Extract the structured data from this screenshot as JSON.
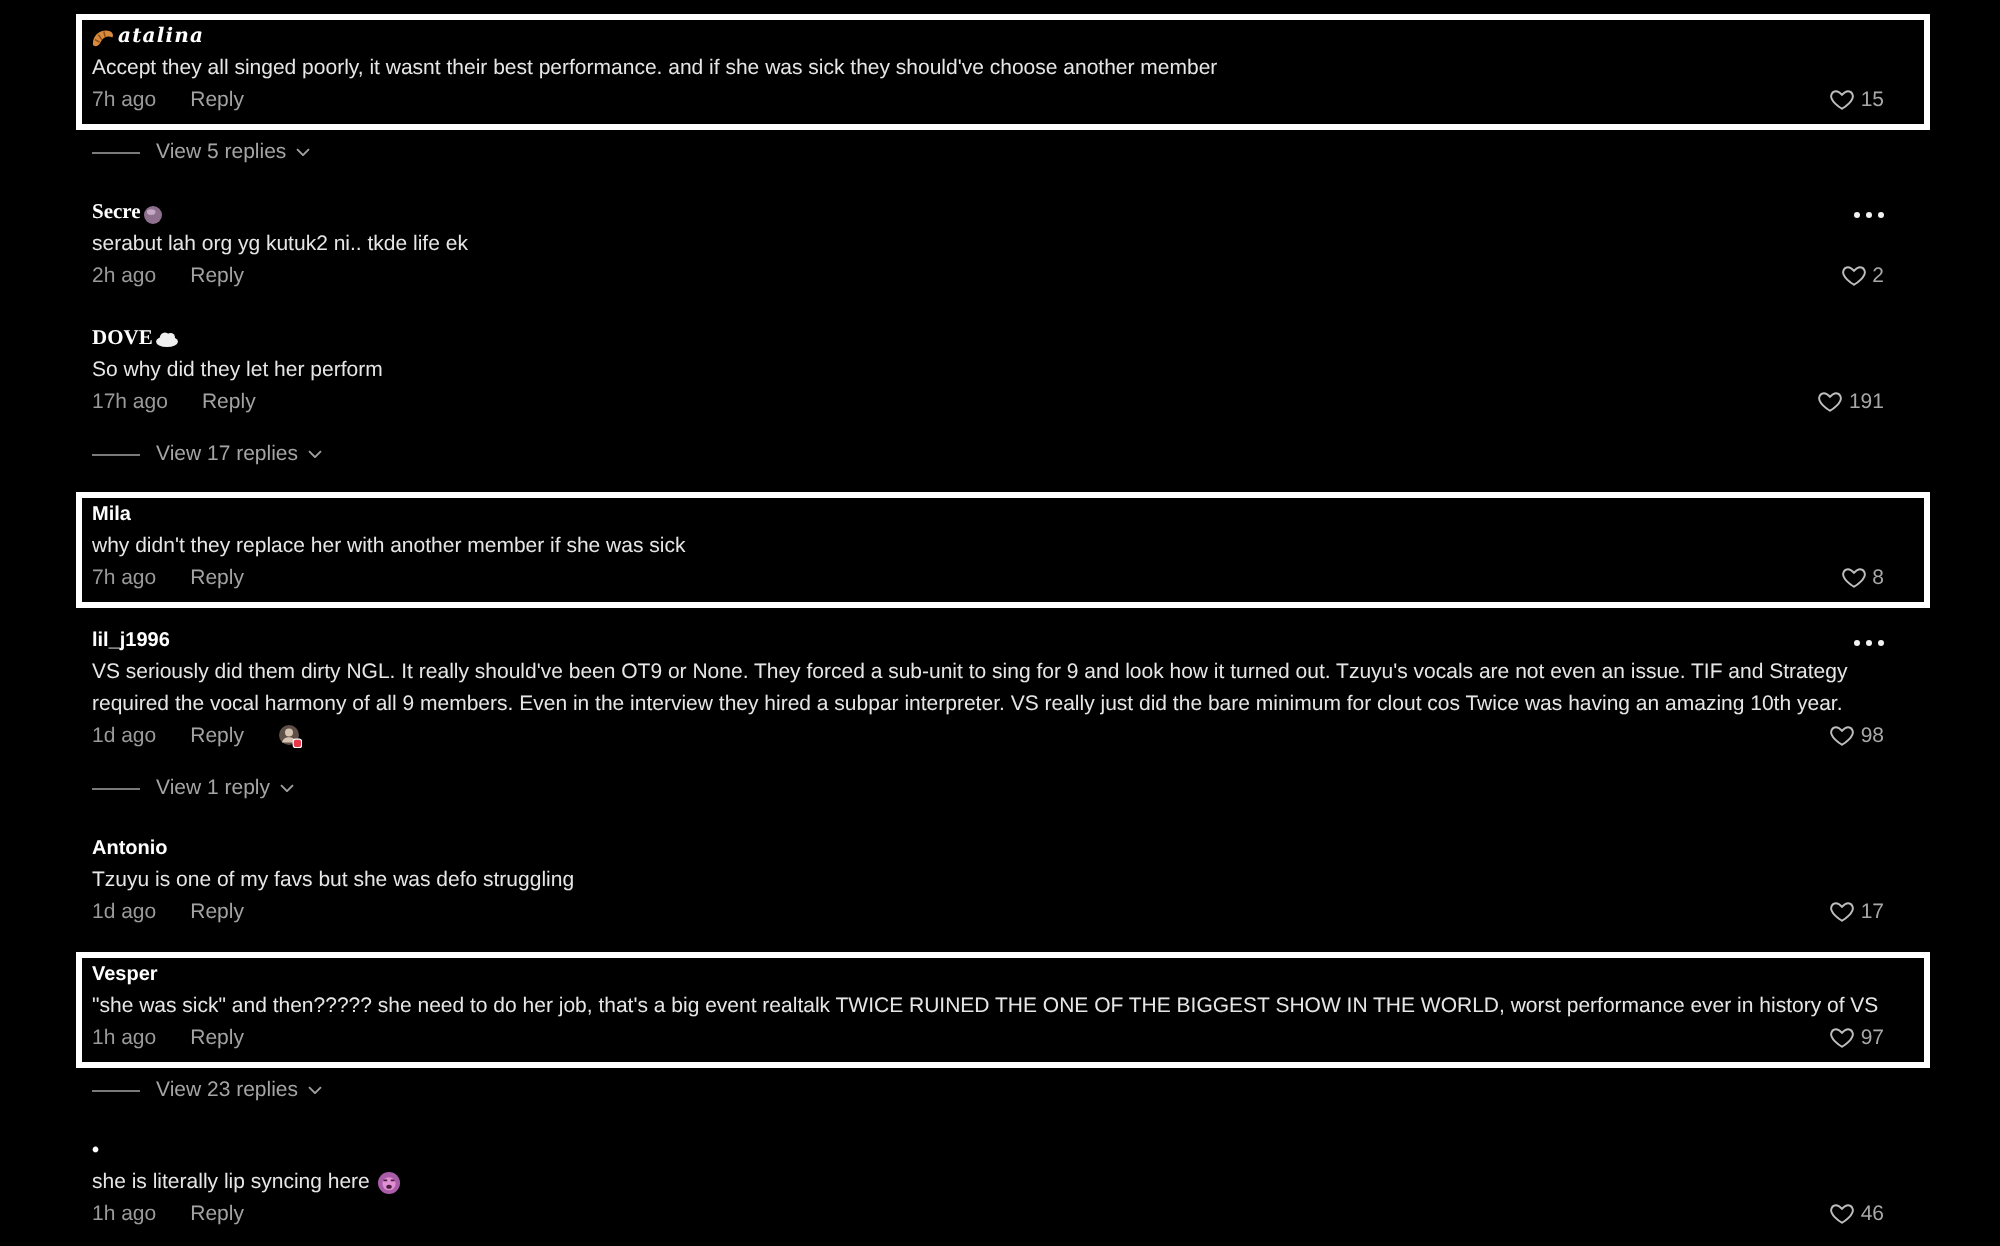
{
  "comments": [
    {
      "author": "atalina",
      "serif_name": true,
      "italic_name": true,
      "lead_icon": {
        "kind": "croissant"
      },
      "text": "Accept they all singed poorly, it wasnt their best performance. and if she was sick they should've choose another member",
      "time": "7h ago",
      "reply": "Reply",
      "likes": "15",
      "highlighted": true,
      "has_menu": false,
      "liked_by_creator": false,
      "replies": "View 5 replies"
    },
    {
      "author": "Secre",
      "serif_name": true,
      "italic_name": false,
      "trail_icon": {
        "kind": "orb"
      },
      "text": "serabut lah org yg kutuk2 ni.. tkde life ek",
      "time": "2h ago",
      "reply": "Reply",
      "likes": "2",
      "highlighted": false,
      "has_menu": true,
      "liked_by_creator": false
    },
    {
      "author": "DOVE",
      "serif_name": true,
      "italic_name": false,
      "trail_icon": {
        "kind": "cloud"
      },
      "text": "So why did they let her perform",
      "time": "17h ago",
      "reply": "Reply",
      "likes": "191",
      "highlighted": false,
      "has_menu": false,
      "liked_by_creator": false,
      "replies": "View 17 replies"
    },
    {
      "author": "Mila",
      "serif_name": false,
      "italic_name": false,
      "text": "why didn't they replace her with another member if she was sick",
      "time": "7h ago",
      "reply": "Reply",
      "likes": "8",
      "highlighted": true,
      "has_menu": false,
      "liked_by_creator": false
    },
    {
      "author": "lil_j1996",
      "serif_name": false,
      "italic_name": false,
      "text": "VS seriously did them dirty NGL. It really should've been OT9 or None. They forced a sub-unit to sing for 9 and look how it turned out. Tzuyu's vocals are not even an issue. TIF and Strategy required the vocal harmony of all 9 members. Even in the interview they hired a subpar interpreter. VS really just did the bare minimum for clout cos Twice was having an amazing 10th year.",
      "time": "1d ago",
      "reply": "Reply",
      "likes": "98",
      "highlighted": false,
      "has_menu": true,
      "liked_by_creator": true,
      "replies": "View 1 reply"
    },
    {
      "author": "Antonio",
      "serif_name": false,
      "italic_name": false,
      "text": "Tzuyu is one of my favs but she was defo struggling",
      "time": "1d ago",
      "reply": "Reply",
      "likes": "17",
      "highlighted": false,
      "has_menu": false,
      "liked_by_creator": false
    },
    {
      "author": "Vesper",
      "serif_name": false,
      "italic_name": false,
      "text": "\"she was sick\" and then????? she need to do her job, that's a big event realtalk TWICE RUINED THE ONE OF THE BIGGEST SHOW IN THE WORLD, worst performance ever in history of VS",
      "time": "1h ago",
      "reply": "Reply",
      "likes": "97",
      "highlighted": true,
      "has_menu": false,
      "liked_by_creator": false,
      "replies": "View 23 replies"
    },
    {
      "author": "•",
      "serif_name": false,
      "italic_name": false,
      "text": "she is literally lip syncing here",
      "text_icon": {
        "kind": "face"
      },
      "time": "1h ago",
      "reply": "Reply",
      "likes": "46",
      "highlighted": false,
      "has_menu": false,
      "liked_by_creator": false
    }
  ]
}
